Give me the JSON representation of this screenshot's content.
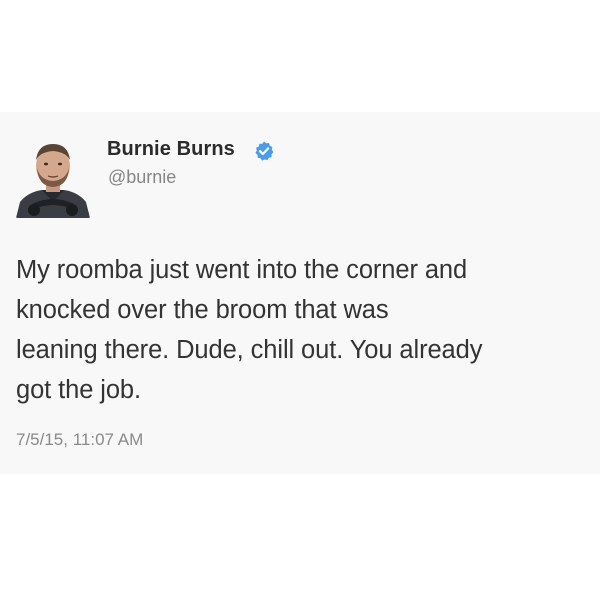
{
  "author": {
    "display_name": "Burnie Burns",
    "handle": "@burnie",
    "verified": true,
    "verified_color": "#4a9de6"
  },
  "tweet": {
    "lines": [
      "My roomba just went into the corner and",
      "knocked over the broom that was",
      "leaning there. Dude, chill out. You already",
      "got the job."
    ],
    "timestamp": "7/5/15, 11:07 AM"
  },
  "colors": {
    "card_background": "#f8f8f8",
    "text": "#333333",
    "secondary_text": "#868686"
  }
}
